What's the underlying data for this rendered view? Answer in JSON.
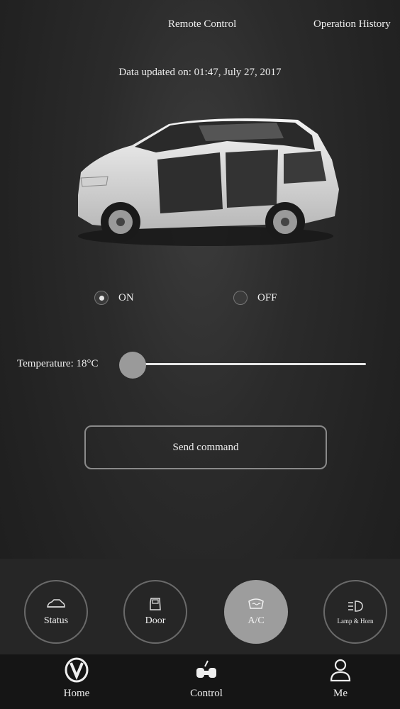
{
  "header": {
    "tabs": [
      {
        "label": "Remote Control"
      },
      {
        "label": "Operation History"
      }
    ]
  },
  "updated_text": "Data updated on: 01:47, July 27, 2017",
  "power": {
    "options": [
      {
        "label": "ON",
        "selected": true
      },
      {
        "label": "OFF",
        "selected": false
      }
    ]
  },
  "temperature": {
    "label": "Temperature: 18°C",
    "value_celsius": 18,
    "slider_fraction": 0.0
  },
  "send_button": {
    "label": "Send command"
  },
  "functions": [
    {
      "label": "Status",
      "icon": "car-icon",
      "active": false
    },
    {
      "label": "Door",
      "icon": "door-icon",
      "active": false
    },
    {
      "label": "A/C",
      "icon": "ac-icon",
      "active": true
    },
    {
      "label": "Lamp & Horn",
      "icon": "lamp-icon",
      "active": false
    }
  ],
  "bottom_nav": [
    {
      "label": "Home",
      "icon": "home-logo-icon"
    },
    {
      "label": "Control",
      "icon": "control-icon"
    },
    {
      "label": "Me",
      "icon": "person-icon"
    }
  ],
  "colors": {
    "background": "#222222",
    "active_function": "#9d9d9d",
    "bottom_nav": "#151515"
  }
}
